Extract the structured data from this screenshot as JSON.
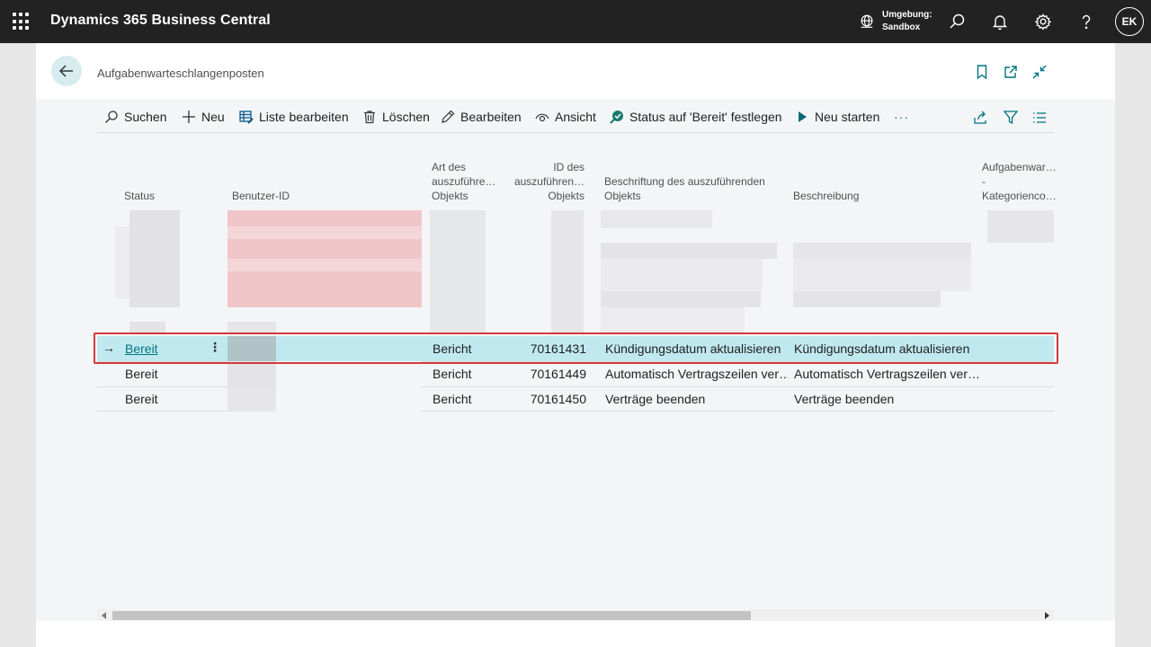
{
  "app": {
    "title": "Dynamics 365 Business Central"
  },
  "environment": {
    "label": "Umgebung:",
    "value": "Sandbox"
  },
  "user": {
    "initials": "EK"
  },
  "page": {
    "title": "Aufgabenwarteschlangenposten"
  },
  "actions": {
    "search": "Suchen",
    "new": "Neu",
    "edit_list": "Liste bearbeiten",
    "delete": "Löschen",
    "edit": "Bearbeiten",
    "view": "Ansicht",
    "set_ready": "Status auf 'Bereit' festlegen",
    "restart": "Neu starten",
    "more": "···"
  },
  "columns": {
    "status": "Status",
    "user_id": "Benutzer-ID",
    "obj_type_1": "Art des",
    "obj_type_2": "auszuführe…",
    "obj_type_3": "Objekts",
    "obj_id_1": "ID des",
    "obj_id_2": "auszuführen…",
    "obj_id_3": "Objekts",
    "caption_1": "Beschriftung des auszuführenden",
    "caption_2": "Objekts",
    "description": "Beschreibung",
    "category_1": "Aufgabenwar…",
    "category_2": "-",
    "category_3": "Kategorienco…"
  },
  "rows": [
    {
      "status": "Bereit",
      "type": "Bericht",
      "id": "70161431",
      "caption": "Kündigungsdatum aktualisieren",
      "description": "Kündigungsdatum aktualisieren",
      "selected": true
    },
    {
      "status": "Bereit",
      "type": "Bericht",
      "id": "70161449",
      "caption": "Automatisch Vertragszeilen ver…",
      "description": "Automatisch Vertragszeilen ver…",
      "selected": false
    },
    {
      "status": "Bereit",
      "type": "Bericht",
      "id": "70161450",
      "caption": "Verträge beenden",
      "description": "Verträge beenden",
      "selected": false
    }
  ],
  "colors": {
    "topbar": "#222222",
    "accent": "#00747f",
    "selected_row": "#c0e9ef",
    "highlight_outline": "#d43a3a"
  }
}
